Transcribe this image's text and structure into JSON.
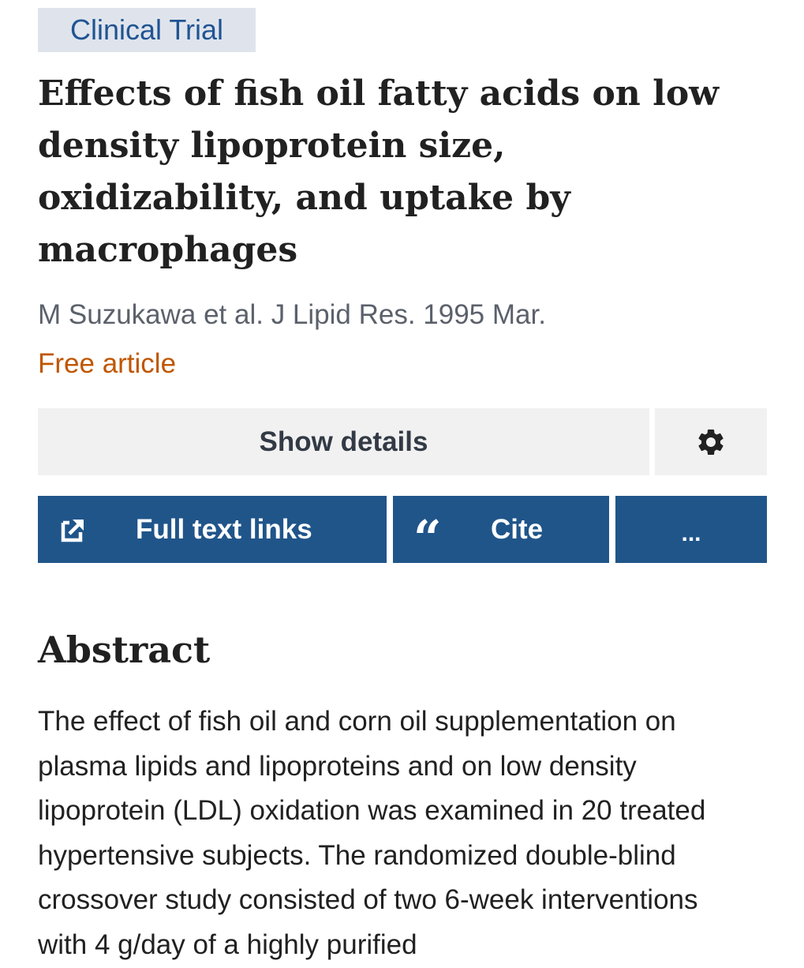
{
  "badge": "Clinical Trial",
  "title": "Effects of fish oil fatty acids on low density lipoprotein size, oxidizability, and uptake by macrophages",
  "citation": "M Suzukawa et al. J Lipid Res. 1995 Mar.",
  "free_label": "Free article",
  "buttons": {
    "show_details": "Show details",
    "full_text": "Full text links",
    "cite": "Cite",
    "more": "..."
  },
  "icons": {
    "settings": "gear-icon",
    "full_text": "external-link-icon",
    "cite": "quote-icon",
    "cite_glyph": "“"
  },
  "abstract": {
    "heading": "Abstract",
    "text": "The effect of fish oil and corn oil supplementation on plasma lipids and lipoproteins and on low density lipoprotein (LDL) oxidation was examined in 20 treated hypertensive subjects. The randomized double-blind crossover study consisted of two 6-week interventions with 4 g/day of a highly purified"
  },
  "colors": {
    "badge_bg": "#dfe4ec",
    "badge_text": "#205493",
    "free_text": "#c05600",
    "primary_button": "#20558a",
    "secondary_button": "#f1f1f1"
  }
}
